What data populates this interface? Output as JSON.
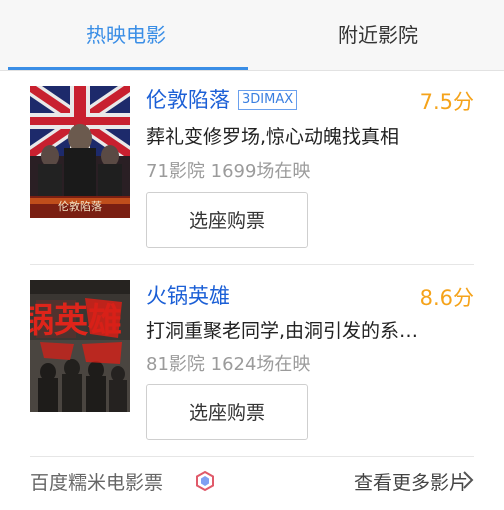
{
  "tabs": [
    {
      "label": "热映电影",
      "active": true
    },
    {
      "label": "附近影院",
      "active": false
    }
  ],
  "movies": [
    {
      "title": "伦敦陷落",
      "format_tag": "3DIMAX",
      "score": "7.5分",
      "description": "葬礼变修罗场,惊心动魄找真相",
      "stats": "71影院 1699场在映",
      "button_label": "选座购票",
      "poster_text": "伦敦陷落"
    },
    {
      "title": "火锅英雄",
      "format_tag": "",
      "score": "8.6分",
      "description": "打洞重聚老同学,由洞引发的系…",
      "stats": "81影院 1624场在映",
      "button_label": "选座购票",
      "poster_text": "火锅英雄"
    }
  ],
  "footer": {
    "brand": "百度糯米电影票",
    "more_label": "查看更多影片"
  },
  "colors": {
    "accent": "#3a8ee6",
    "title": "#1b5fd6",
    "score": "#f5a31a"
  }
}
